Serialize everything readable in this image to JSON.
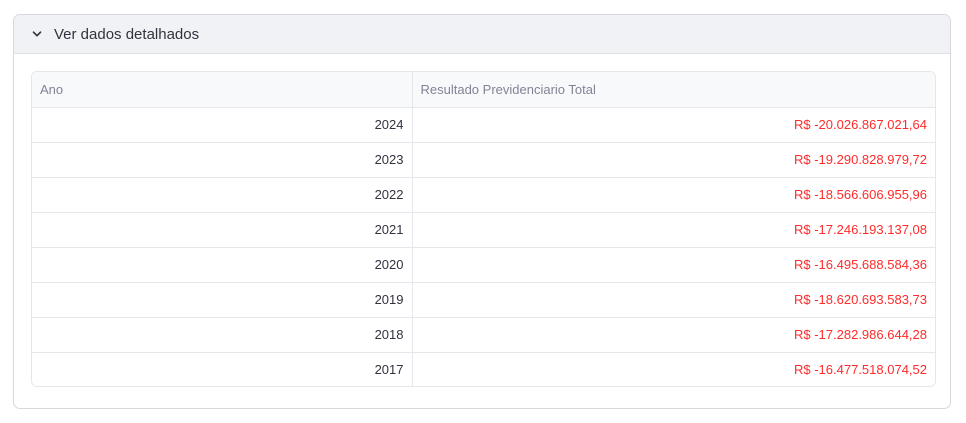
{
  "expander": {
    "title": "Ver dados detalhados",
    "icon": "chevron-down-icon"
  },
  "table": {
    "columns": [
      "Ano",
      "Resultado Previdenciario Total"
    ],
    "rows": [
      {
        "ano": "2024",
        "valor": "R$ -20.026.867.021,64"
      },
      {
        "ano": "2023",
        "valor": "R$ -19.290.828.979,72"
      },
      {
        "ano": "2022",
        "valor": "R$ -18.566.606.955,96"
      },
      {
        "ano": "2021",
        "valor": "R$ -17.246.193.137,08"
      },
      {
        "ano": "2020",
        "valor": "R$ -16.495.688.584,36"
      },
      {
        "ano": "2019",
        "valor": "R$ -18.620.693.583,73"
      },
      {
        "ano": "2018",
        "valor": "R$ -17.282.986.644,28"
      },
      {
        "ano": "2017",
        "valor": "R$ -16.477.518.074,52"
      }
    ]
  },
  "colors": {
    "negative_value": "#ff2b2b",
    "header_bg": "#f0f2f6",
    "text": "#31333f"
  }
}
